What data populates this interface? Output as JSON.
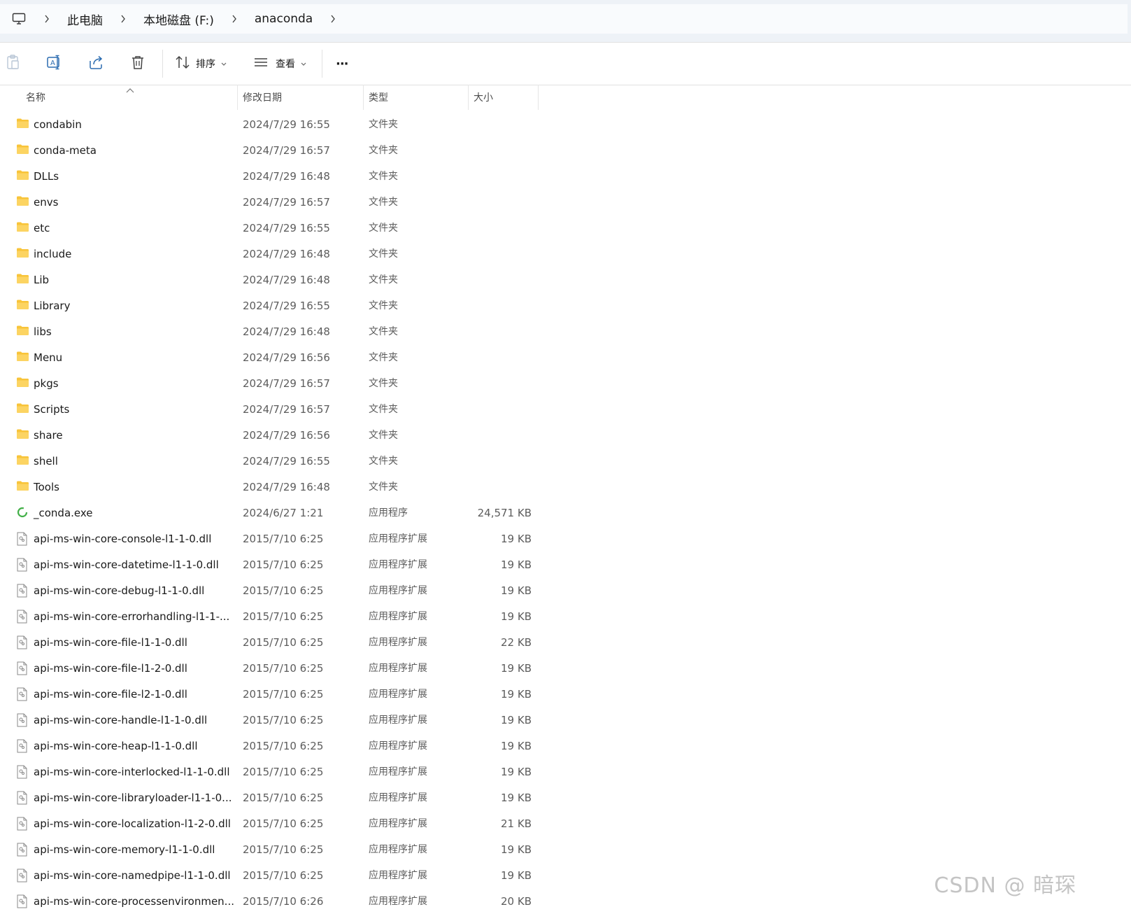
{
  "address_bar": {
    "crumbs": [
      "此电脑",
      "本地磁盘 (F:)",
      "anaconda"
    ]
  },
  "toolbar": {
    "sort_label": "排序",
    "view_label": "查看",
    "more_label": "···"
  },
  "columns": {
    "name": "名称",
    "date": "修改日期",
    "type": "类型",
    "size": "大小"
  },
  "rows": [
    {
      "icon": "folder-icon",
      "name": "condabin",
      "date": "2024/7/29 16:55",
      "type": "文件夹",
      "size": ""
    },
    {
      "icon": "folder-icon",
      "name": "conda-meta",
      "date": "2024/7/29 16:57",
      "type": "文件夹",
      "size": ""
    },
    {
      "icon": "folder-icon",
      "name": "DLLs",
      "date": "2024/7/29 16:48",
      "type": "文件夹",
      "size": ""
    },
    {
      "icon": "folder-icon",
      "name": "envs",
      "date": "2024/7/29 16:57",
      "type": "文件夹",
      "size": ""
    },
    {
      "icon": "folder-icon",
      "name": "etc",
      "date": "2024/7/29 16:55",
      "type": "文件夹",
      "size": ""
    },
    {
      "icon": "folder-icon",
      "name": "include",
      "date": "2024/7/29 16:48",
      "type": "文件夹",
      "size": ""
    },
    {
      "icon": "folder-icon",
      "name": "Lib",
      "date": "2024/7/29 16:48",
      "type": "文件夹",
      "size": ""
    },
    {
      "icon": "folder-icon",
      "name": "Library",
      "date": "2024/7/29 16:55",
      "type": "文件夹",
      "size": ""
    },
    {
      "icon": "folder-icon",
      "name": "libs",
      "date": "2024/7/29 16:48",
      "type": "文件夹",
      "size": ""
    },
    {
      "icon": "folder-icon",
      "name": "Menu",
      "date": "2024/7/29 16:56",
      "type": "文件夹",
      "size": ""
    },
    {
      "icon": "folder-icon",
      "name": "pkgs",
      "date": "2024/7/29 16:57",
      "type": "文件夹",
      "size": ""
    },
    {
      "icon": "folder-icon",
      "name": "Scripts",
      "date": "2024/7/29 16:57",
      "type": "文件夹",
      "size": ""
    },
    {
      "icon": "folder-icon",
      "name": "share",
      "date": "2024/7/29 16:56",
      "type": "文件夹",
      "size": ""
    },
    {
      "icon": "folder-icon",
      "name": "shell",
      "date": "2024/7/29 16:55",
      "type": "文件夹",
      "size": ""
    },
    {
      "icon": "folder-icon",
      "name": "Tools",
      "date": "2024/7/29 16:48",
      "type": "文件夹",
      "size": ""
    },
    {
      "icon": "conda-exe-icon",
      "name": "_conda.exe",
      "date": "2024/6/27 1:21",
      "type": "应用程序",
      "size": "24,571 KB"
    },
    {
      "icon": "dll-file-icon",
      "name": "api-ms-win-core-console-l1-1-0.dll",
      "date": "2015/7/10 6:25",
      "type": "应用程序扩展",
      "size": "19 KB"
    },
    {
      "icon": "dll-file-icon",
      "name": "api-ms-win-core-datetime-l1-1-0.dll",
      "date": "2015/7/10 6:25",
      "type": "应用程序扩展",
      "size": "19 KB"
    },
    {
      "icon": "dll-file-icon",
      "name": "api-ms-win-core-debug-l1-1-0.dll",
      "date": "2015/7/10 6:25",
      "type": "应用程序扩展",
      "size": "19 KB"
    },
    {
      "icon": "dll-file-icon",
      "name": "api-ms-win-core-errorhandling-l1-1-...",
      "date": "2015/7/10 6:25",
      "type": "应用程序扩展",
      "size": "19 KB"
    },
    {
      "icon": "dll-file-icon",
      "name": "api-ms-win-core-file-l1-1-0.dll",
      "date": "2015/7/10 6:25",
      "type": "应用程序扩展",
      "size": "22 KB"
    },
    {
      "icon": "dll-file-icon",
      "name": "api-ms-win-core-file-l1-2-0.dll",
      "date": "2015/7/10 6:25",
      "type": "应用程序扩展",
      "size": "19 KB"
    },
    {
      "icon": "dll-file-icon",
      "name": "api-ms-win-core-file-l2-1-0.dll",
      "date": "2015/7/10 6:25",
      "type": "应用程序扩展",
      "size": "19 KB"
    },
    {
      "icon": "dll-file-icon",
      "name": "api-ms-win-core-handle-l1-1-0.dll",
      "date": "2015/7/10 6:25",
      "type": "应用程序扩展",
      "size": "19 KB"
    },
    {
      "icon": "dll-file-icon",
      "name": "api-ms-win-core-heap-l1-1-0.dll",
      "date": "2015/7/10 6:25",
      "type": "应用程序扩展",
      "size": "19 KB"
    },
    {
      "icon": "dll-file-icon",
      "name": "api-ms-win-core-interlocked-l1-1-0.dll",
      "date": "2015/7/10 6:25",
      "type": "应用程序扩展",
      "size": "19 KB"
    },
    {
      "icon": "dll-file-icon",
      "name": "api-ms-win-core-libraryloader-l1-1-0...",
      "date": "2015/7/10 6:25",
      "type": "应用程序扩展",
      "size": "19 KB"
    },
    {
      "icon": "dll-file-icon",
      "name": "api-ms-win-core-localization-l1-2-0.dll",
      "date": "2015/7/10 6:25",
      "type": "应用程序扩展",
      "size": "21 KB"
    },
    {
      "icon": "dll-file-icon",
      "name": "api-ms-win-core-memory-l1-1-0.dll",
      "date": "2015/7/10 6:25",
      "type": "应用程序扩展",
      "size": "19 KB"
    },
    {
      "icon": "dll-file-icon",
      "name": "api-ms-win-core-namedpipe-l1-1-0.dll",
      "date": "2015/7/10 6:25",
      "type": "应用程序扩展",
      "size": "19 KB"
    },
    {
      "icon": "dll-file-icon",
      "name": "api-ms-win-core-processenvironmen...",
      "date": "2015/7/10 6:26",
      "type": "应用程序扩展",
      "size": "20 KB"
    }
  ],
  "watermark": "CSDN @ 暗琛",
  "colors": {
    "folder": "#f8c43a",
    "conda_green": "#43b049",
    "toolbar_blue": "#2b6cb0"
  }
}
